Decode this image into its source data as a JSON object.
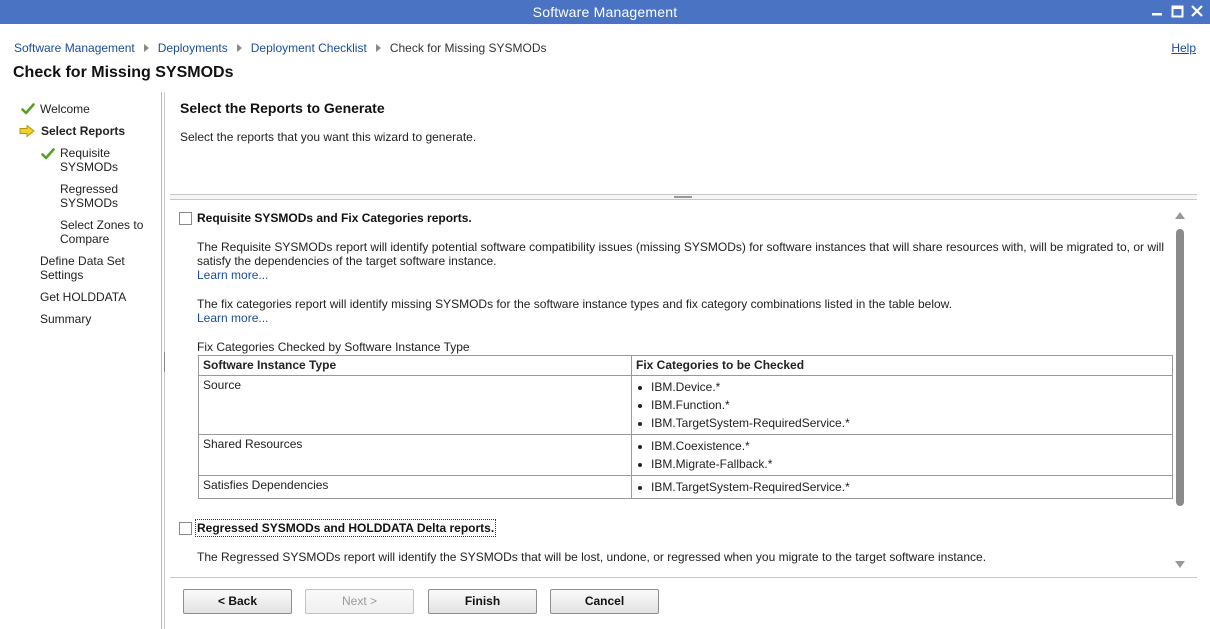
{
  "window": {
    "title": "Software Management"
  },
  "breadcrumb": {
    "items": [
      "Software Management",
      "Deployments",
      "Deployment Checklist"
    ],
    "current": "Check for Missing SYSMODs"
  },
  "help_label": "Help",
  "page_title": "Check for Missing SYSMODs",
  "nav": {
    "welcome": "Welcome",
    "select_reports": "Select Reports",
    "requisite_l1": "Requisite",
    "requisite_l2": "SYSMODs",
    "regressed_l1": "Regressed",
    "regressed_l2": "SYSMODs",
    "zones_l1": "Select Zones to",
    "zones_l2": "Compare",
    "define_l1": "Define Data Set",
    "define_l2": "Settings",
    "holddata": "Get HOLDDATA",
    "summary": "Summary"
  },
  "main": {
    "heading": "Select the Reports to Generate",
    "subtext": "Select the reports that you want this wizard to generate.",
    "option1": {
      "label": "Requisite SYSMODs and Fix Categories reports.",
      "checked": false,
      "para1": "The Requisite SYSMODs report will identify potential software compatibility issues (missing SYSMODs) for software instances that will share resources with, will be migrated to, or will satisfy the dependencies of the target software instance.",
      "learn_more_1": "Learn more...",
      "para2": "The fix categories report will identify missing SYSMODs for the software instance types and fix category combinations listed in the table below.",
      "learn_more_2": "Learn more...",
      "table_caption": "Fix Categories Checked by Software Instance Type",
      "table": {
        "headers": [
          "Software Instance Type",
          "Fix Categories to be Checked"
        ],
        "rows": [
          {
            "type": "Source",
            "categories": [
              "IBM.Device.*",
              "IBM.Function.*",
              "IBM.TargetSystem-RequiredService.*"
            ]
          },
          {
            "type": "Shared Resources",
            "categories": [
              "IBM.Coexistence.*",
              "IBM.Migrate-Fallback.*"
            ]
          },
          {
            "type": "Satisfies Dependencies",
            "categories": [
              "IBM.TargetSystem-RequiredService.*"
            ]
          }
        ]
      }
    },
    "option2": {
      "label": "Regressed SYSMODs and HOLDDATA Delta reports.",
      "checked": false,
      "para1": "The Regressed SYSMODs report will identify the SYSMODs that will be lost, undone, or regressed when you migrate to the target software instance."
    }
  },
  "buttons": {
    "back": "< Back",
    "next": "Next >",
    "finish": "Finish",
    "cancel": "Cancel"
  },
  "colors": {
    "titlebar": "#4a73c3",
    "link": "#1a4d9e",
    "check": "#5a9e2a",
    "arrow": "#e8c21c"
  }
}
